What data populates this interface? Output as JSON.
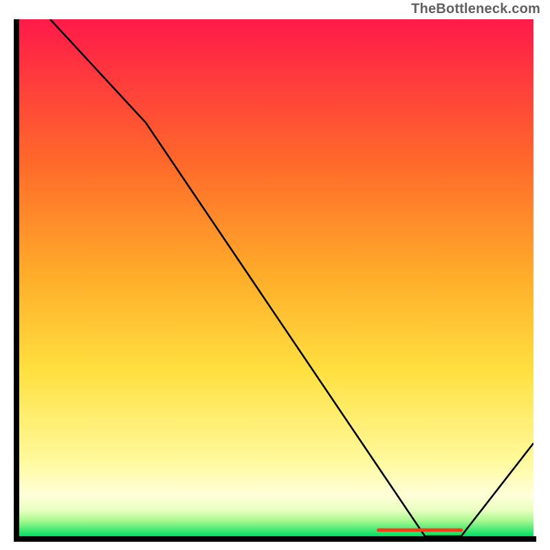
{
  "attribution": "TheBottleneck.com",
  "colors": {
    "gradient_top": "#ff1a4a",
    "gradient_mid_orange": "#ff9a2a",
    "gradient_mid_yellow": "#ffe040",
    "gradient_pale": "#ffffcc",
    "gradient_bottom": "#00e060",
    "axis": "#000000",
    "curve": "#000000",
    "segment": "#ff3a1a"
  },
  "chart_data": {
    "type": "line",
    "title": "",
    "xlabel": "",
    "ylabel": "",
    "xlim": [
      0,
      100
    ],
    "ylim": [
      0,
      100
    ],
    "series": [
      {
        "name": "curve",
        "x": [
          6.5,
          25,
          79,
          82,
          86,
          100
        ],
        "y": [
          100,
          80,
          0,
          0,
          0,
          18
        ]
      },
      {
        "name": "flat-segment-marker",
        "x": [
          70,
          86
        ],
        "y": [
          1.2,
          1.2
        ]
      }
    ],
    "annotations": []
  }
}
